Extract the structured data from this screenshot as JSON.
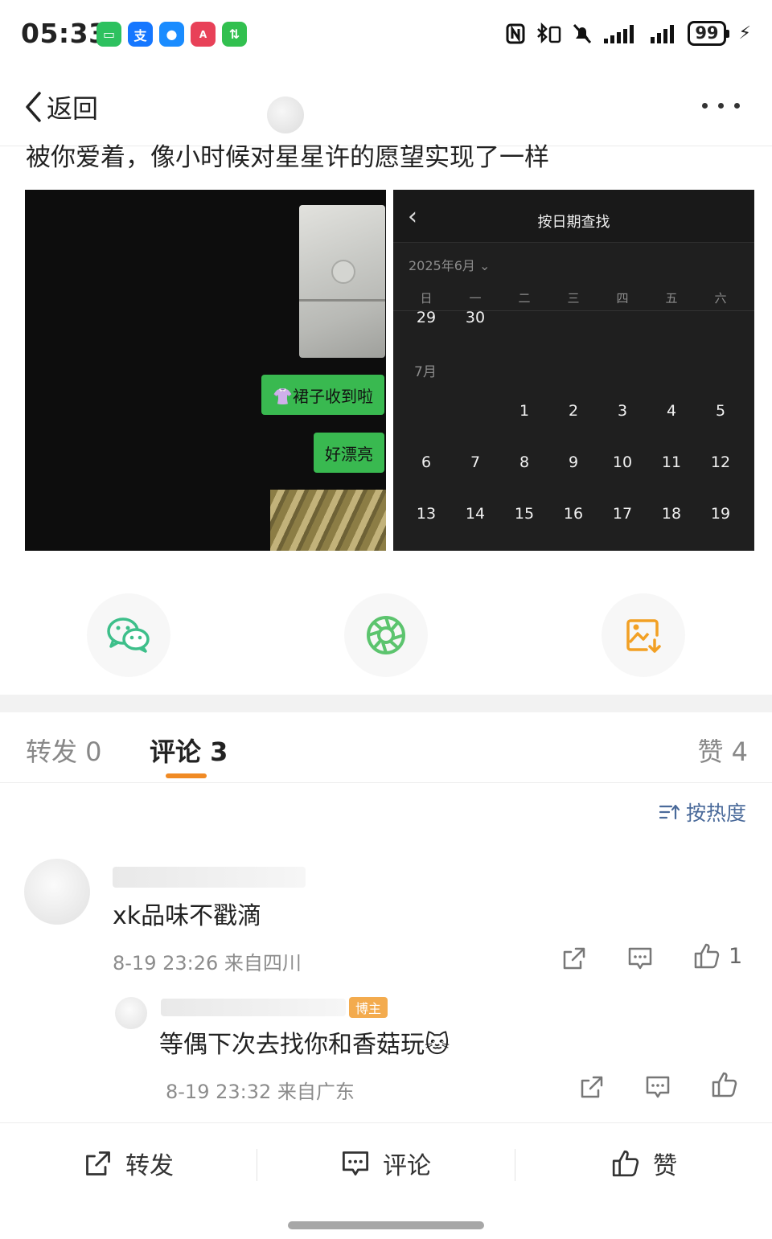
{
  "status_bar": {
    "time": "05:33",
    "apps": [
      {
        "icon": "wechat-app-icon",
        "color": "#2dc15f",
        "glyph": "▭"
      },
      {
        "icon": "alipay-app-icon",
        "color": "#1677ff",
        "glyph": "支"
      },
      {
        "icon": "message-app-icon",
        "color": "#1a8cff",
        "glyph": "●"
      },
      {
        "icon": "appgallery-app-icon",
        "color": "#e84158",
        "glyph": "A"
      },
      {
        "icon": "transfer-app-icon",
        "color": "#32c04f",
        "glyph": "⇅"
      }
    ],
    "battery_level": "99"
  },
  "nav": {
    "back_label": "返回"
  },
  "post": {
    "text": "被你爱着，像小时候对星星许的愿望实现了一样",
    "chat_bubbles": [
      "👚裙子收到啦",
      "好漂亮"
    ],
    "calendar": {
      "title": "按日期查找",
      "month_select": "2025年6月",
      "weekdays": [
        "日",
        "一",
        "二",
        "三",
        "四",
        "五",
        "六"
      ],
      "june_days": [
        "29",
        "30"
      ],
      "month_label": "7月",
      "july_weeks": [
        [
          "",
          "",
          "1",
          "2",
          "3",
          "4",
          "5"
        ],
        [
          "6",
          "7",
          "8",
          "9",
          "10",
          "11",
          "12"
        ],
        [
          "13",
          "14",
          "15",
          "16",
          "17",
          "18",
          "19"
        ]
      ]
    }
  },
  "tabs": {
    "repost": "转发 0",
    "comments": "评论 3",
    "likes": "赞 4"
  },
  "sort": {
    "label": "按热度"
  },
  "comments": [
    {
      "text": "xk品味不戳滴",
      "meta": "8-19 23:26 来自四川",
      "like_count": "1"
    }
  ],
  "reply": {
    "badge": "博主",
    "text": "等偶下次去找你和香菇玩🐱",
    "meta": "8-19 23:32 来自广东"
  },
  "bottom_bar": {
    "repost": "转发",
    "comment": "评论",
    "like": "赞"
  },
  "colors": {
    "accent": "#f08a24",
    "link": "#4a6a9a",
    "wechat_green": "#3dbf8a",
    "moments_green": "#5cc46e",
    "save_orange": "#f2a024",
    "chat_green": "#39b950"
  }
}
